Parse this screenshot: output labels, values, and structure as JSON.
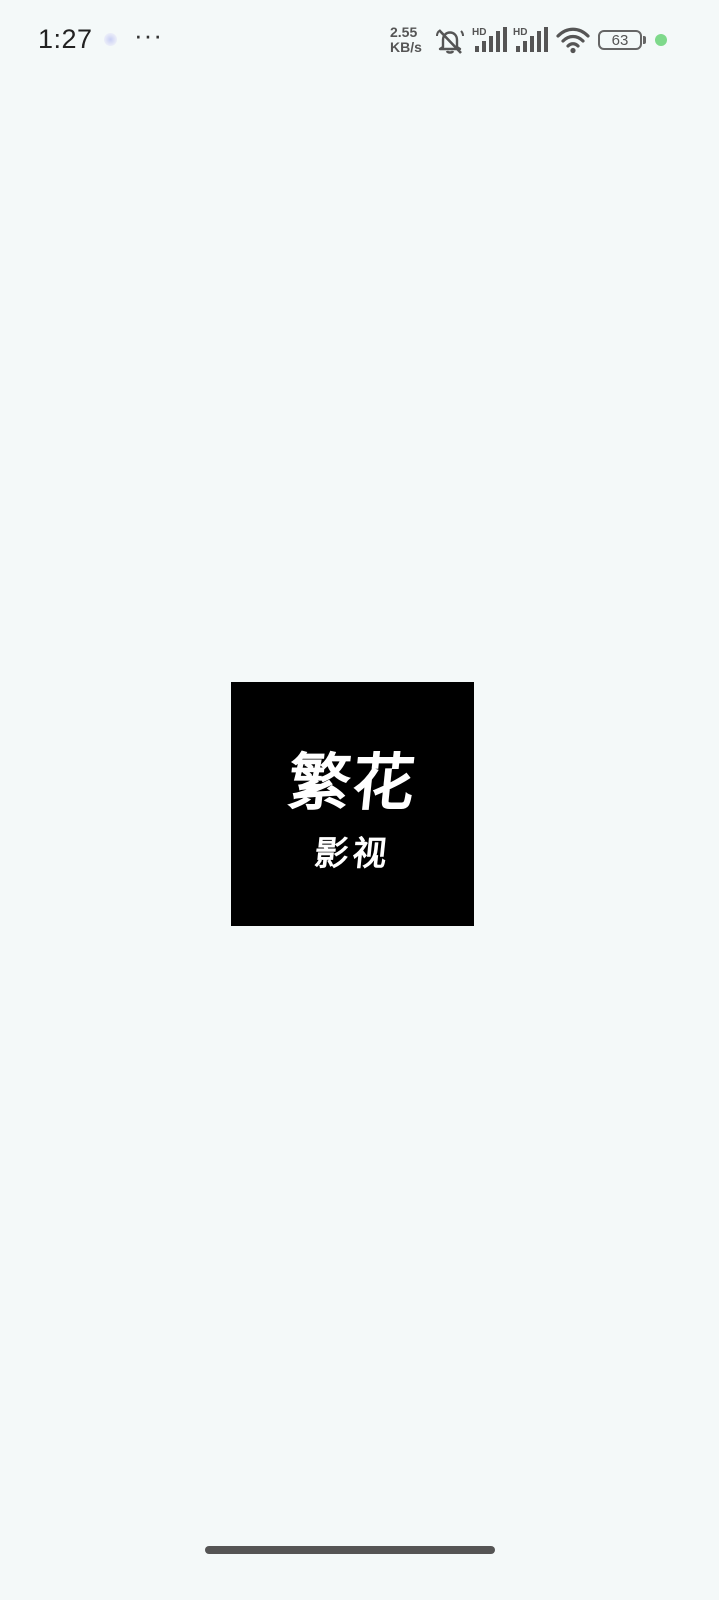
{
  "status_bar": {
    "time": "1:27",
    "more": "···",
    "net_speed_value": "2.55",
    "net_speed_unit": "KB/s",
    "signal1_label": "HD",
    "signal2_label": "HD",
    "battery_level": "63",
    "icons": [
      "notification-dot",
      "more-icon",
      "mute-icon",
      "signal-icon",
      "signal-icon",
      "wifi-icon",
      "battery-icon",
      "green-dot"
    ],
    "colors": {
      "green_dot": "#7ed98b",
      "text": "#2b2b2b"
    }
  },
  "splash": {
    "logo_line1": "繁花",
    "logo_line2": "影视",
    "logo_background": "#000000",
    "page_background": "#f4f9f9"
  }
}
